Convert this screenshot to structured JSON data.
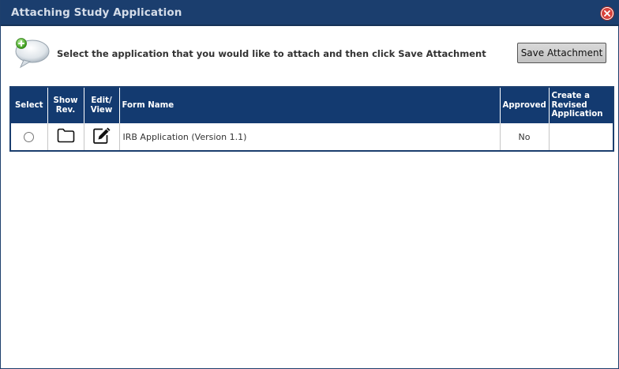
{
  "dialog": {
    "title": "Attaching Study Application",
    "instructions": "Select the application that you would like to attach and then click Save Attachment",
    "save_label": "Save Attachment"
  },
  "table": {
    "headers": {
      "select": "Select",
      "show_rev": "Show Rev.",
      "edit_view": "Edit/ View",
      "form_name": "Form Name",
      "approved": "Approved",
      "create_revised": "Create a Revised Application"
    },
    "rows": [
      {
        "form_name": "IRB Application (Version 1.1)",
        "approved": "No",
        "create_revised": ""
      }
    ]
  },
  "icons": {
    "close": "close-icon",
    "bubble": "add-comment-bubble-icon",
    "folder": "folder-icon",
    "edit": "edit-pencil-icon"
  },
  "colors": {
    "header_bg": "#133a70",
    "title_bar": "#1b3e6e",
    "close": "#d8413a"
  }
}
